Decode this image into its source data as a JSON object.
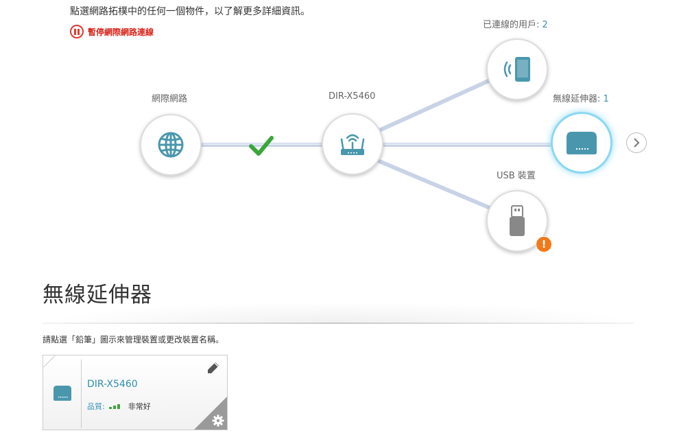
{
  "intro_text": "點選網路拓樸中的任何一個物件，以了解更多詳細資訊。",
  "pause_label": "暫停網際網路連線",
  "nodes": {
    "internet": {
      "label": "網際網路",
      "icon": "globe-icon"
    },
    "router": {
      "label": "DIR-X5460",
      "icon": "router-icon"
    },
    "clients": {
      "label": "已連線的用戶: ",
      "count": "2",
      "icon": "wireless-device-icon"
    },
    "extender": {
      "label": "無線延伸器: ",
      "count": "1",
      "icon": "extender-icon"
    },
    "usb": {
      "label": "USB 裝置",
      "icon": "usb-drive-icon",
      "alert": "!"
    }
  },
  "section_title": "無線延伸器",
  "instruction": "請點選「鉛筆」圖示來管理裝置或更改裝置名稱。",
  "card": {
    "name": "DIR-X5460",
    "quality_label": "品質:",
    "quality_value": "非常好",
    "signal_level": 3
  },
  "colors": {
    "accent": "#2f8fb2",
    "icon_teal": "#4a97ad",
    "link_line": "#c9d3e6",
    "check_green": "#3aa63a",
    "alert_orange": "#f07a1b",
    "pause_red": "#d8261b"
  }
}
